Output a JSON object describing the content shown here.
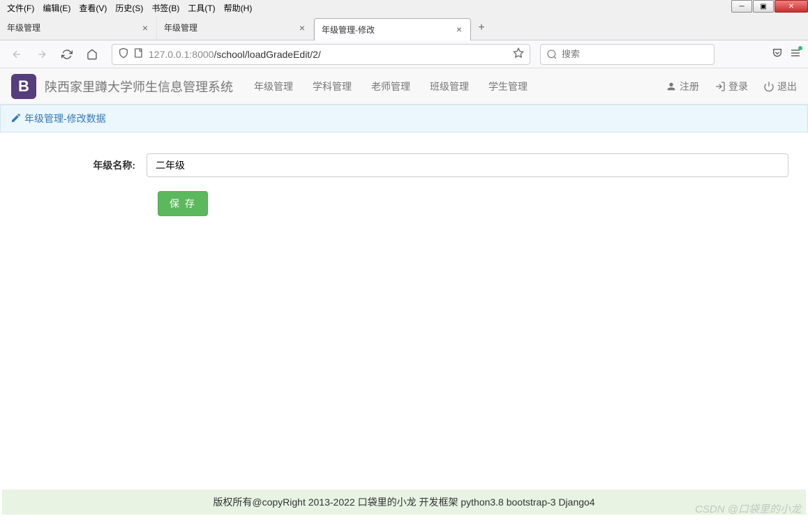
{
  "menubar": [
    "文件(F)",
    "编辑(E)",
    "查看(V)",
    "历史(S)",
    "书签(B)",
    "工具(T)",
    "帮助(H)"
  ],
  "tabs": [
    {
      "title": "年级管理",
      "active": false
    },
    {
      "title": "年级管理",
      "active": false
    },
    {
      "title": "年级管理-修改",
      "active": true
    }
  ],
  "url": {
    "host": "127.0.0.1",
    "port": ":8000",
    "path": "/school/loadGradeEdit/2/"
  },
  "search_placeholder": "搜索",
  "navbar": {
    "brand": "B",
    "brand_text": "陕西家里蹲大学师生信息管理系统",
    "links": [
      "年级管理",
      "学科管理",
      "老师管理",
      "班级管理",
      "学生管理"
    ],
    "right": {
      "register": "注册",
      "login": "登录",
      "logout": "退出"
    }
  },
  "breadcrumb": "年级管理-修改数据",
  "form": {
    "label": "年级名称:",
    "value": "二年级",
    "save": "保 存"
  },
  "footer": "版权所有@copyRight 2013-2022 口袋里的小龙 开发框架 python3.8 bootstrap-3 Django4",
  "watermark": "CSDN @口袋里的小龙"
}
